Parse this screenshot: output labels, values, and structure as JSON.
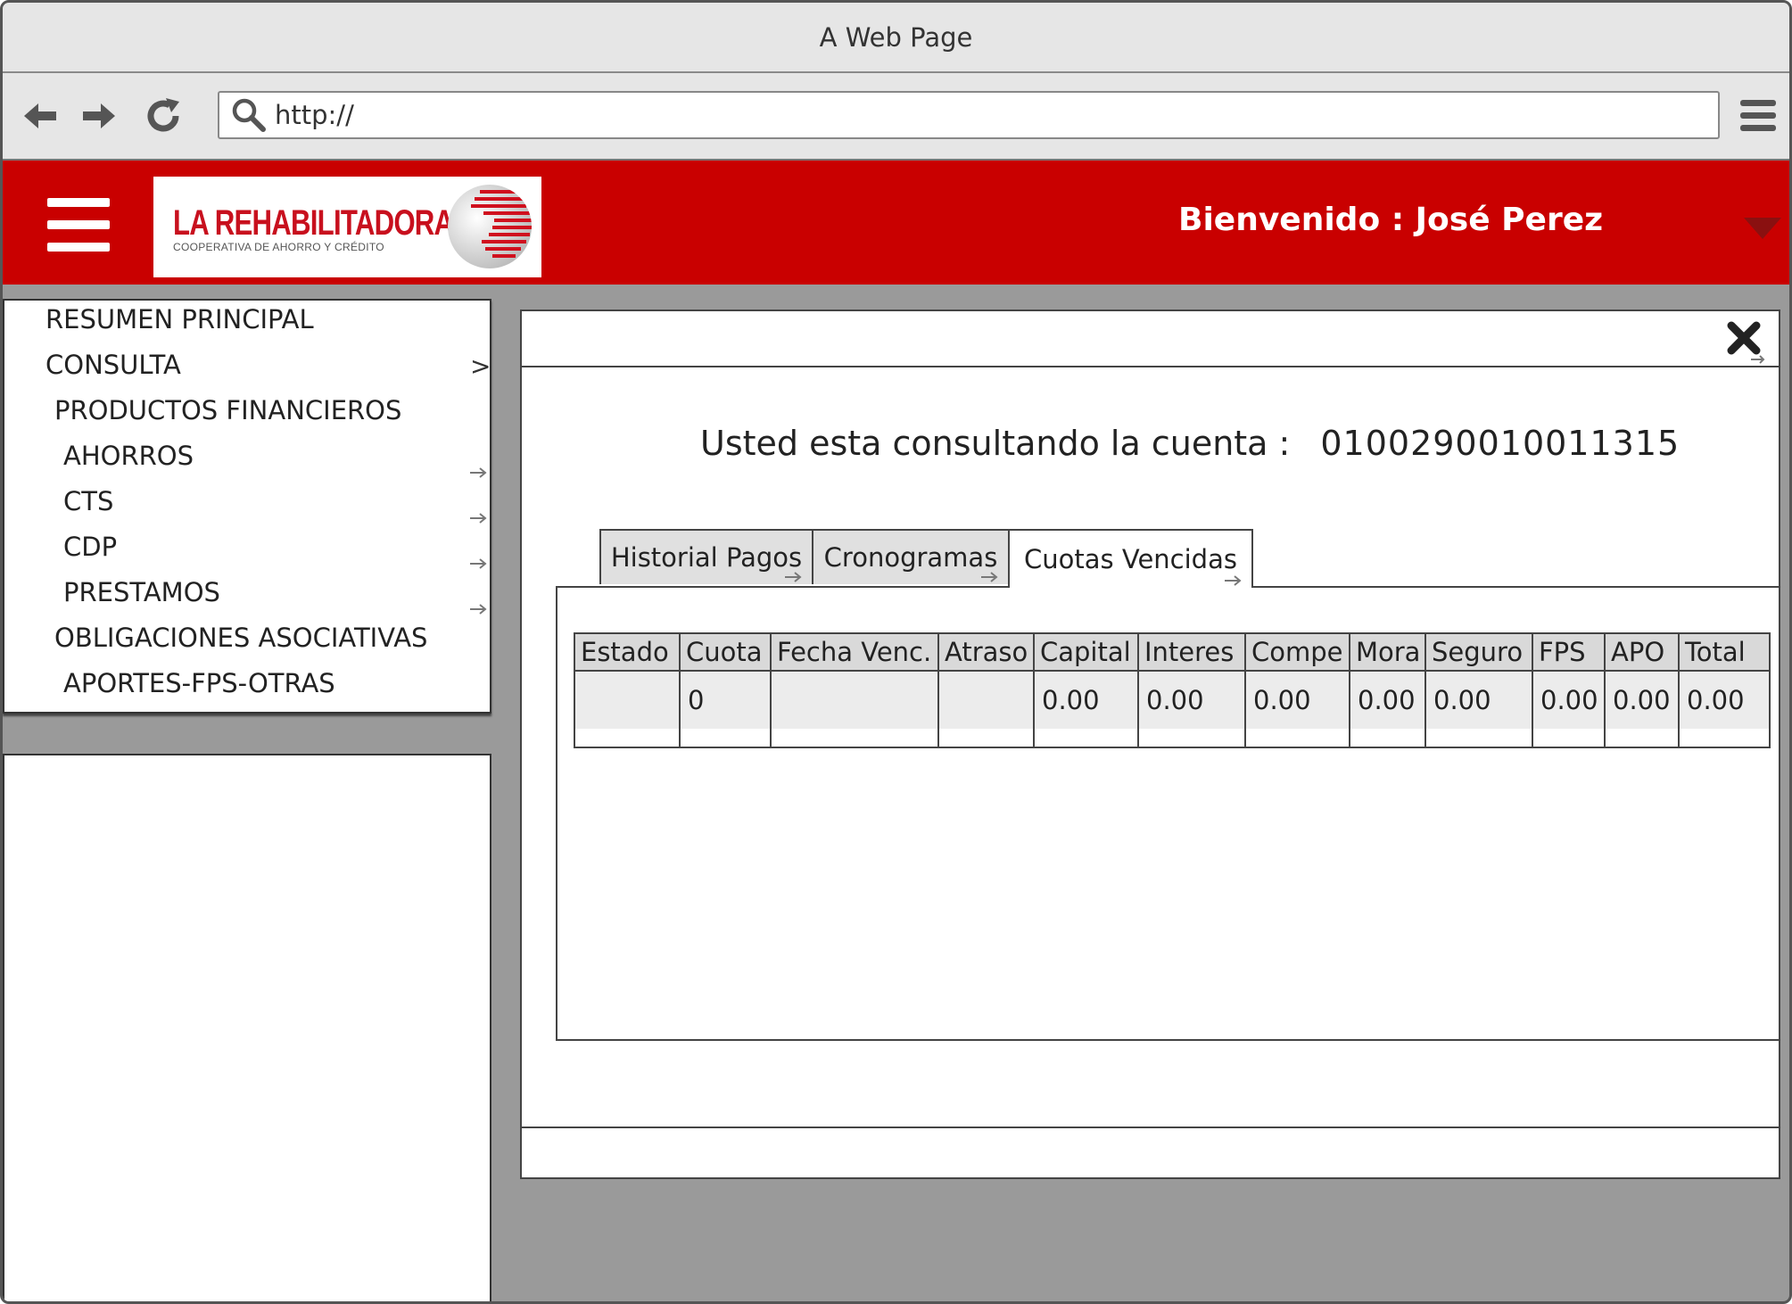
{
  "browser": {
    "title": "A Web Page",
    "url": "http://"
  },
  "header": {
    "logo_name": "LA REHABILITADORA",
    "logo_subtitle": "COOPERATIVA DE AHORRO Y CRÉDITO",
    "welcome": "Bienvenido : José Perez",
    "brand_color": "#c90000"
  },
  "sidebar": {
    "items": [
      {
        "label": "RESUMEN PRINCIPAL"
      },
      {
        "label": "CONSULTA"
      },
      {
        "label": "PRODUCTOS FINANCIEROS"
      },
      {
        "label": "AHORROS"
      },
      {
        "label": "CTS"
      },
      {
        "label": "CDP"
      },
      {
        "label": "PRESTAMOS"
      },
      {
        "label": "OBLIGACIONES ASOCIATIVAS"
      },
      {
        "label": "APORTES-FPS-OTRAS"
      }
    ],
    "consulta_chevron": ">"
  },
  "modal": {
    "account_label": "Usted esta consultando la cuenta :",
    "account_number": "010029001001​1315",
    "tabs": [
      {
        "label": "Historial Pagos"
      },
      {
        "label": "Cronogramas"
      },
      {
        "label": "Cuotas Vencidas",
        "active": true
      }
    ],
    "table": {
      "columns": [
        "Estado",
        "Cuota",
        "Fecha Venc.",
        "Atraso",
        "Capital",
        "Interes",
        "Compe",
        "Mora",
        "Seguro",
        "FPS",
        "APO",
        "Total"
      ],
      "rows": [
        [
          "",
          "0",
          "",
          "",
          "0.00",
          "0.00",
          "0.00",
          "0.00",
          "0.00",
          "0.00",
          "0.00",
          "0.00"
        ]
      ]
    }
  }
}
